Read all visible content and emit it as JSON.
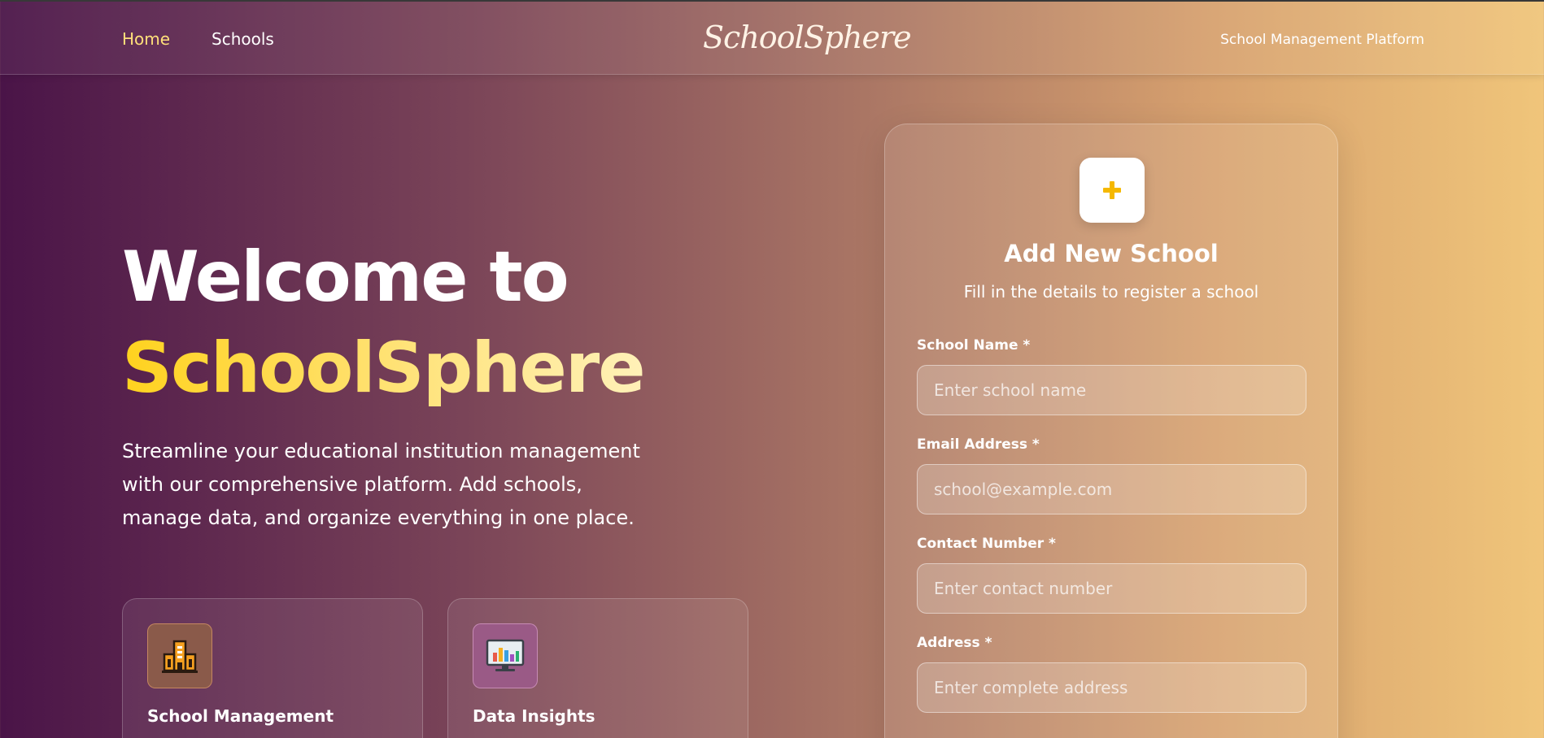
{
  "nav": {
    "links": [
      {
        "label": "Home",
        "active": true
      },
      {
        "label": "Schools",
        "active": false
      }
    ],
    "brand": "SchoolSphere",
    "tagline": "School Management Platform"
  },
  "hero": {
    "title_line1": "Welcome to",
    "title_line2": "SchoolSphere",
    "description": "Streamline your educational institution management with our comprehensive platform. Add schools, manage data, and organize everything in one place."
  },
  "features": [
    {
      "icon": "school-building-icon",
      "title": "School Management"
    },
    {
      "icon": "chart-monitor-icon",
      "title": "Data Insights"
    }
  ],
  "form": {
    "icon": "plus-icon",
    "title": "Add New School",
    "subtitle": "Fill in the details to register a school",
    "fields": [
      {
        "label": "School Name *",
        "placeholder": "Enter school name"
      },
      {
        "label": "Email Address *",
        "placeholder": "school@example.com"
      },
      {
        "label": "Contact Number *",
        "placeholder": "Enter contact number"
      },
      {
        "label": "Address *",
        "placeholder": "Enter complete address"
      }
    ]
  },
  "colors": {
    "accent_yellow": "#ffd21e",
    "nav_active": "#ffe07a",
    "gradient_start": "#4a1448",
    "gradient_end": "#f0c57a"
  }
}
